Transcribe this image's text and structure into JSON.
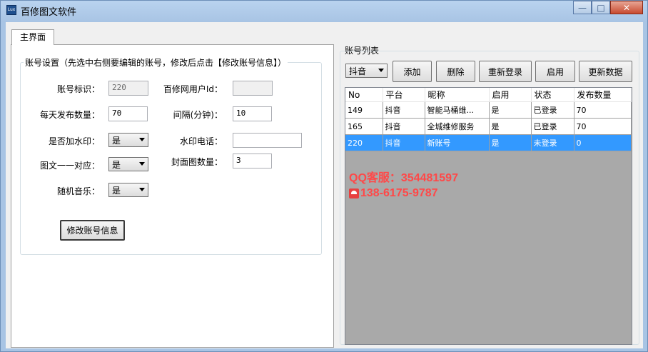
{
  "window": {
    "title": "百修图文软件",
    "icon_text": "Lux"
  },
  "tab": {
    "label": "主界面"
  },
  "settings": {
    "legend": "账号设置（先选中右侧要编辑的账号，修改后点击【修改账号信息】）",
    "account_id_label": "账号标识：",
    "account_id_value": "220",
    "daily_posts_label": "每天发布数量：",
    "daily_posts_value": "70",
    "watermark_label": "是否加水印：",
    "watermark_value": "是",
    "one_to_one_label": "图文一一对应：",
    "one_to_one_value": "是",
    "random_music_label": "随机音乐：",
    "random_music_value": "是",
    "baixiu_user_label": "百修网用户Id：",
    "baixiu_user_value": "",
    "interval_label": "间隔(分钟)：",
    "interval_value": "10",
    "watermark_phone_label": "水印电话：",
    "watermark_phone_value": "",
    "cover_count_label": "封面图数量：",
    "cover_count_value": "3",
    "update_button": "修改账号信息"
  },
  "accounts": {
    "title": "账号列表",
    "platform_value": "抖音",
    "add_button": "添加",
    "delete_button": "删除",
    "relogin_button": "重新登录",
    "enable_button": "启用",
    "refresh_button": "更新数据",
    "columns": [
      "No",
      "平台",
      "昵称",
      "启用",
      "状态",
      "发布数量"
    ],
    "rows": [
      [
        "149",
        "抖音",
        "智能马桶维...",
        "是",
        "已登录",
        "70"
      ],
      [
        "165",
        "抖音",
        "全城维修服务",
        "是",
        "已登录",
        "70"
      ],
      [
        "220",
        "抖音",
        "新账号",
        "是",
        "未登录",
        "0"
      ]
    ],
    "selected_row": 2
  },
  "watermark_overlay": {
    "qq": "QQ客服：354481597",
    "phone": "138-6175-9787",
    "color": "#ff4848"
  }
}
